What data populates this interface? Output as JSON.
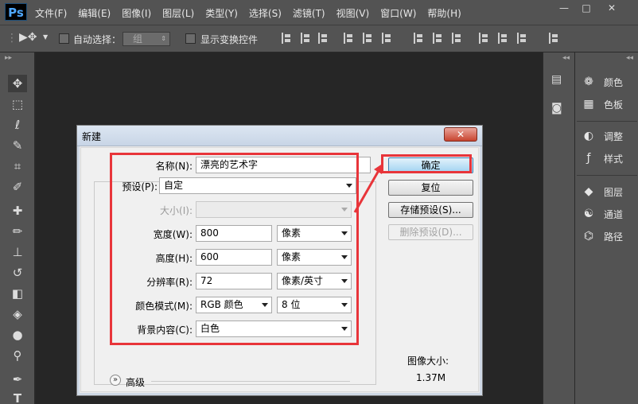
{
  "app": {
    "logo": "Ps",
    "menu": [
      "文件(F)",
      "编辑(E)",
      "图像(I)",
      "图层(L)",
      "类型(Y)",
      "选择(S)",
      "滤镜(T)",
      "视图(V)",
      "窗口(W)",
      "帮助(H)"
    ],
    "window_controls": {
      "minimize": "—",
      "maximize": "□",
      "close": "✕"
    }
  },
  "options_bar": {
    "auto_select_label": "自动选择：",
    "auto_select_value": "组",
    "show_transform_label": "显示变换控件",
    "auto_select_checked": false,
    "show_transform_checked": false
  },
  "tools": [
    "move-tool-icon",
    "marquee-tool-icon",
    "lasso-tool-icon",
    "quick-select-tool-icon",
    "crop-tool-icon",
    "eyedropper-tool-icon",
    "healing-brush-tool-icon",
    "brush-tool-icon",
    "clone-stamp-tool-icon",
    "history-brush-tool-icon",
    "eraser-tool-icon",
    "paint-bucket-tool-icon",
    "blur-tool-icon",
    "dodge-tool-icon",
    "pen-tool-icon",
    "type-tool-icon"
  ],
  "panels": {
    "items": [
      {
        "label": "颜色",
        "icon": "color-palette-icon"
      },
      {
        "label": "色板",
        "icon": "swatches-grid-icon"
      },
      {
        "label": "调整",
        "icon": "adjustments-icon"
      },
      {
        "label": "样式",
        "icon": "styles-fx-icon"
      },
      {
        "label": "图层",
        "icon": "layers-icon"
      },
      {
        "label": "通道",
        "icon": "channels-icon"
      },
      {
        "label": "路径",
        "icon": "paths-icon"
      }
    ]
  },
  "dialog": {
    "title": "新建",
    "close_label": "✕",
    "name_label": "名称(N):",
    "name_value": "漂亮的艺术字",
    "preset_label": "预设(P):",
    "preset_value": "自定",
    "size_label": "大小(I):",
    "size_value": "",
    "width_label": "宽度(W):",
    "width_value": "800",
    "width_unit": "像素",
    "height_label": "高度(H):",
    "height_value": "600",
    "height_unit": "像素",
    "resolution_label": "分辨率(R):",
    "resolution_value": "72",
    "resolution_unit": "像素/英寸",
    "color_mode_label": "颜色模式(M):",
    "color_mode_value": "RGB 颜色",
    "color_depth_value": "8 位",
    "background_label": "背景内容(C):",
    "background_value": "白色",
    "advanced_label": "高级",
    "image_size_label": "图像大小:",
    "image_size_value": "1.37M",
    "buttons": {
      "ok": "确定",
      "reset": "复位",
      "save_preset": "存储预设(S)...",
      "delete_preset": "删除预设(D)..."
    }
  },
  "annotation_color": "#e8353a"
}
